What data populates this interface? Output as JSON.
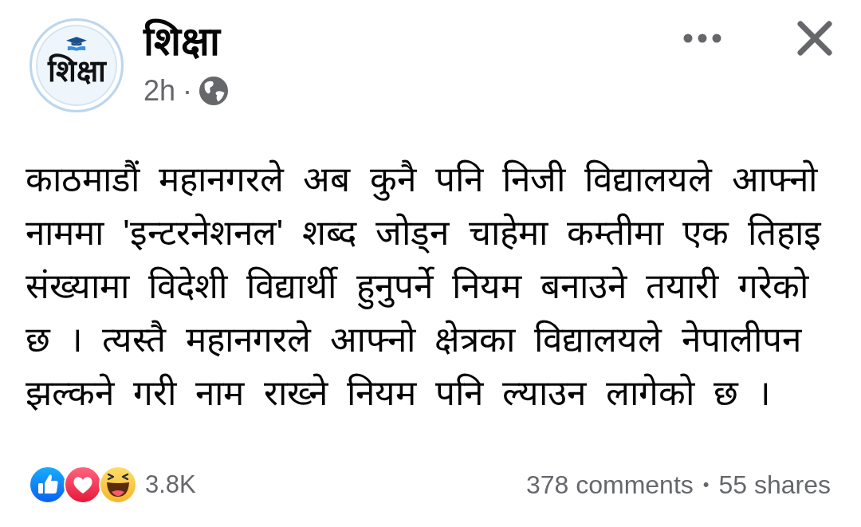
{
  "header": {
    "avatar_text": "शिक्षा",
    "author": "शिक्षा",
    "time": "2h",
    "separator": "·"
  },
  "body": "काठमाडौं महानगरले अब कुनै पनि निजी विद्यालयले आफ्नो नाममा 'इन्टरनेशनल' शब्द जोड्न चाहेमा कम्तीमा एक तिहाइ संख्यामा विदेशी विद्यार्थी हुनुपर्ने नियम बनाउने तयारी गरेको छ । त्यस्तै महानगरले आफ्नो क्षेत्रका विद्यालयले नेपालीपन झल्कने गरी नाम राख्ने नियम पनि ल्याउन लागेको छ ।",
  "footer": {
    "reactions": [
      {
        "kind": "like"
      },
      {
        "kind": "love"
      },
      {
        "kind": "haha"
      }
    ],
    "reaction_count": "3.8K",
    "comments": "378 comments",
    "separator": "•",
    "shares": "55 shares"
  }
}
